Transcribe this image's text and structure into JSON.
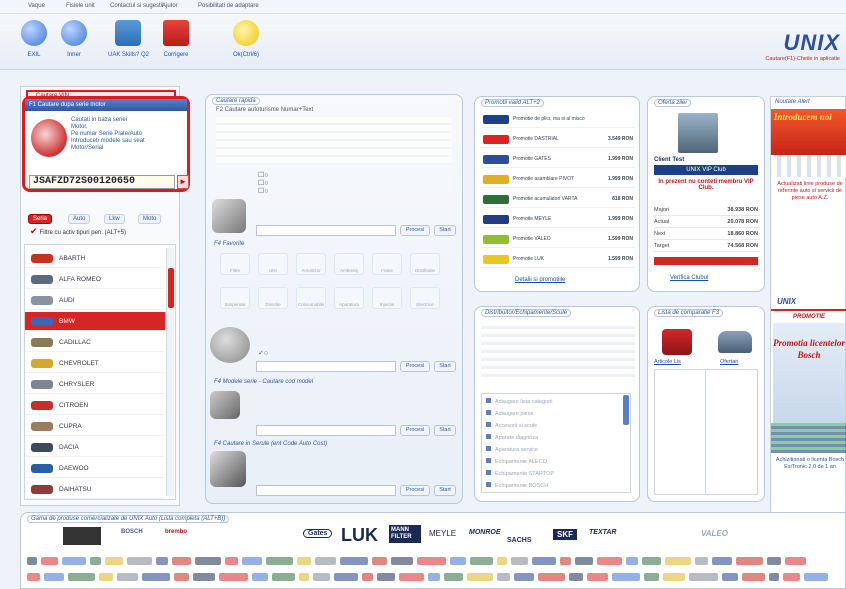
{
  "menu": [
    "Vaque",
    "Fisiele unit",
    "Contactul si sugestii",
    "Ajutor",
    "Posibilitati de adaptare"
  ],
  "toolbar": {
    "items": [
      {
        "label": "EXIL",
        "icon": "undo-arrow-icon"
      },
      {
        "label": "Inner",
        "icon": "redo-arrow-icon"
      },
      {
        "label": "UAK Skills? Q2",
        "icon": "network-computers-icon"
      },
      {
        "label": "Corrigere",
        "icon": "home-icon"
      },
      {
        "label": "Ok(Ctrl/6)",
        "icon": "lightbulb-icon"
      }
    ]
  },
  "logo": {
    "brand": "UNIX",
    "sub": "Cautare(F1)-Cheile in aplicatie"
  },
  "vin_panel": {
    "dropdown": "Cautare VIN",
    "header": "F1 Cautare dupa serie motor",
    "desc": [
      "Cautati in baza seriei",
      "Motor,",
      "Pe numar Serie Plate/Auto",
      "Introduceti modele sau seat",
      "Motor/Serial"
    ],
    "vin": "JSAFZD72S00120650"
  },
  "left_tabs": [
    "Seria",
    "Auto",
    "Lkw",
    "Moto"
  ],
  "filter_label": "Filtre cu activ tipuri pen. (ALT+5)",
  "brands": [
    {
      "name": "ABARTH",
      "color": "#c9301d",
      "selected": false
    },
    {
      "name": "ALFA ROMEO",
      "color": "#5b6a80",
      "selected": false
    },
    {
      "name": "AUDI",
      "color": "#8a929c",
      "selected": false
    },
    {
      "name": "BMW",
      "color": "#3a66b5",
      "selected": true
    },
    {
      "name": "CADILLAC",
      "color": "#8a7a55",
      "selected": false
    },
    {
      "name": "CHEVROLET",
      "color": "#d4a82a",
      "selected": false
    },
    {
      "name": "CHRYSLER",
      "color": "#7b8594",
      "selected": false
    },
    {
      "name": "CITROEN",
      "color": "#c03030",
      "selected": false
    },
    {
      "name": "CUPRA",
      "color": "#9c7c5a",
      "selected": false
    },
    {
      "name": "DACIA",
      "color": "#3d4a5c",
      "selected": false
    },
    {
      "name": "DAEWOO",
      "color": "#2b5ea5",
      "selected": false
    },
    {
      "name": "DAIHATSU",
      "color": "#8f3b3b",
      "selected": false
    }
  ],
  "center": {
    "title": "Cautare rapida",
    "sub": "F2 Cautare autoturisme Numar+Text",
    "search_btn": "Procesi",
    "start_btn": "Start",
    "f4_label": "F4 Favorite",
    "icon_labels": [
      "Filtre",
      "Ulei",
      "Amortizor",
      "Ambreiaj",
      "Frane",
      "Distributie",
      "Suspensie",
      "Directie",
      "Consumabile",
      "Aparatura",
      "Injectie",
      "Electrice"
    ],
    "f5_label": "F4 Modele serie - Cautare cod model",
    "f6_label": "F4 Cautare in Serule (ent Code Auto Cost)"
  },
  "promo": {
    "title": "Promotii valid ALT+2",
    "rows": [
      {
        "name": "Promotie de plicr, ma si al misco",
        "price": "",
        "color": "#1c3f8a"
      },
      {
        "name": "Promotie DASTRIAL",
        "price": "3.549 RON",
        "color": "#d22"
      },
      {
        "name": "Promotie GATES",
        "price": "1.999 RON",
        "color": "#2b4d9b"
      },
      {
        "name": "Promotie asamblare PIVOT",
        "price": "1.999 RON",
        "color": "#e0b020"
      },
      {
        "name": "Promotie acumulatori VARTA",
        "price": "818 RON",
        "color": "#2d6e3a"
      },
      {
        "name": "Promotie MEYLE",
        "price": "1.999 RON",
        "color": "#1f3d80"
      },
      {
        "name": "Promotie VALEO",
        "price": "1.599 RON",
        "color": "#8fbf2a"
      },
      {
        "name": "Promotie LUK",
        "price": "1.599 RON",
        "color": "#e8c820"
      }
    ],
    "footer": "Detalii si promotiile"
  },
  "offer": {
    "title": "Oferta zilei",
    "client": "Client Test",
    "club": "UNIX VIP Club",
    "msg": "In prezent nu conteti membru VIP Club.",
    "table": [
      {
        "k": "Majori",
        "v": "38.938 RON"
      },
      {
        "k": "Actual",
        "v": "20.078 RON"
      },
      {
        "k": "Next",
        "v": "18.860 RON"
      },
      {
        "k": "Target",
        "v": "74.568 RON"
      }
    ],
    "footer": "Verifica Clubul"
  },
  "alerts": {
    "title": "Noutate Alert",
    "headline": "Introducem noi",
    "text": "Actualizati linie produse de referinte auto si servicii de piese auto A.Z.",
    "promo_brand": "UNIX",
    "promo": "PROMOTIE",
    "promo2": "Promotia licentelor Bosch",
    "tail": "Achizitionati o licenta Bosch EsiTronic 2.0 de 1 an"
  },
  "dist": {
    "title": "Distribuitor/Echipamente/Scule",
    "rows": [
      "Adaugare lista categorii",
      "Adaugare piese",
      "Accesorii si scule",
      "Aparate diagnoza",
      "Aparatura service",
      "Echipamente ALECO",
      "Echipamente STARTOP",
      "Echipamente BOSCH"
    ]
  },
  "compare": {
    "title": "Lista de comparatie F3",
    "left": "Articole Lis",
    "right": "Ofertari"
  },
  "bottom": {
    "title": "Gama de produse comercializate de UNIX Auto (Lista completa (ALT+B))",
    "logos": [
      "BOSCH",
      "brembo",
      "Gates",
      "LUK",
      "MANN FILTER",
      "MEYLE",
      "MONROE",
      "SACHS",
      "SKF",
      "TEXTAR",
      "VALEO"
    ]
  }
}
